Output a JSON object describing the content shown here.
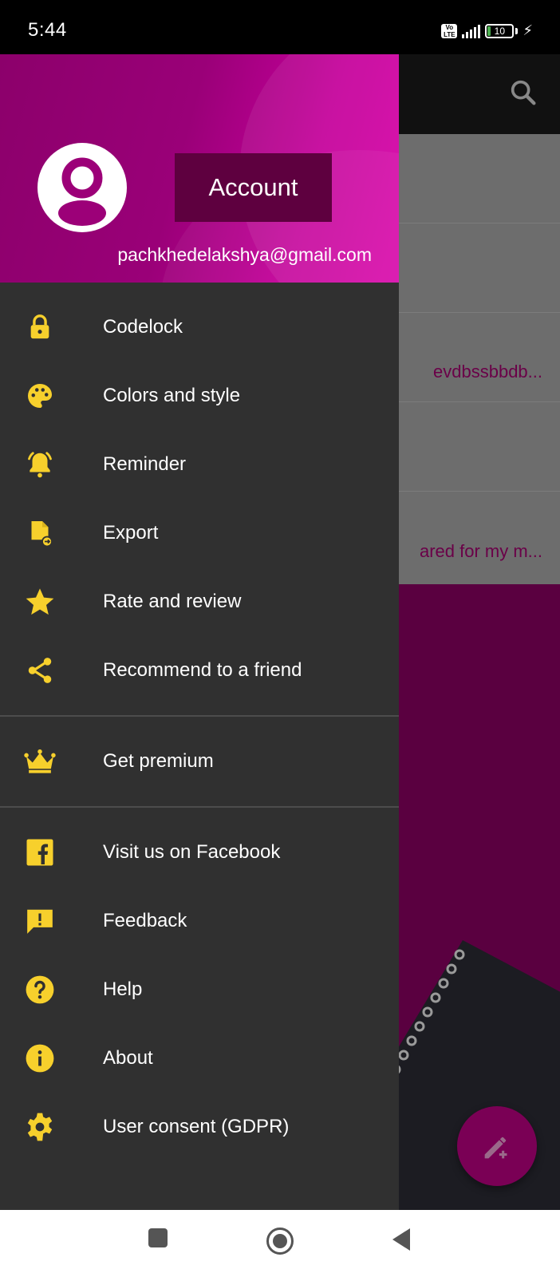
{
  "status_bar": {
    "time": "5:44",
    "volte": "Vo LTE",
    "battery": "10",
    "charging_icon": "bolt-icon"
  },
  "drawer": {
    "header": {
      "account_button": "Account",
      "email": "pachkhedelakshya@gmail.com"
    },
    "items": [
      {
        "label": "Codelock",
        "icon": "lock-icon"
      },
      {
        "label": "Colors and style",
        "icon": "palette-icon"
      },
      {
        "label": "Reminder",
        "icon": "bell-icon"
      },
      {
        "label": "Export",
        "icon": "file-export-icon"
      },
      {
        "label": "Rate and review",
        "icon": "star-icon"
      },
      {
        "label": "Recommend to a friend",
        "icon": "share-icon"
      }
    ],
    "premium": {
      "label": "Get premium",
      "icon": "crown-icon"
    },
    "more_items": [
      {
        "label": "Visit us on Facebook",
        "icon": "facebook-icon"
      },
      {
        "label": "Feedback",
        "icon": "feedback-icon"
      },
      {
        "label": "Help",
        "icon": "help-icon"
      },
      {
        "label": "About",
        "icon": "info-icon"
      },
      {
        "label": "User consent (GDPR)",
        "icon": "gear-icon"
      }
    ]
  },
  "background": {
    "note_previews": [
      "evdbssbbdb...",
      "ared for my m..."
    ]
  },
  "colors": {
    "accent": "#f7d02c",
    "drawer_bg": "#303030",
    "header_magenta": "#a0007a",
    "account_btn": "#5e003f"
  }
}
